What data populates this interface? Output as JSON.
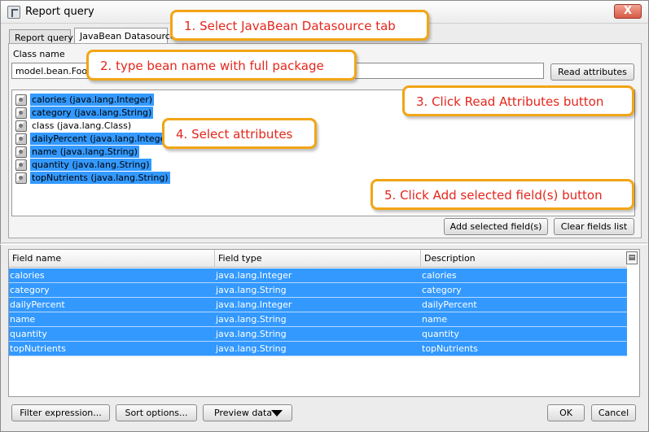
{
  "window": {
    "title": "Report query",
    "close_label": "X"
  },
  "tabs": [
    {
      "label": "Report query"
    },
    {
      "label": "JavaBean Datasource"
    }
  ],
  "class_name": {
    "label": "Class name",
    "value": "model.bean.Food"
  },
  "buttons": {
    "read_attributes": "Read attributes",
    "add_selected": "Add selected field(s)",
    "clear_fields": "Clear fields list",
    "filter_expression": "Filter expression...",
    "sort_options": "Sort options...",
    "preview_data": "Preview data",
    "ok": "OK",
    "cancel": "Cancel"
  },
  "attributes": [
    {
      "text": "calories (java.lang.Integer)",
      "selected": true
    },
    {
      "text": "category (java.lang.String)",
      "selected": true
    },
    {
      "text": "class (java.lang.Class)",
      "selected": false
    },
    {
      "text": "dailyPercent (java.lang.Integer)",
      "selected": true
    },
    {
      "text": "name (java.lang.String)",
      "selected": true
    },
    {
      "text": "quantity (java.lang.String)",
      "selected": true
    },
    {
      "text": "topNutrients (java.lang.String)",
      "selected": true
    }
  ],
  "table": {
    "columns": [
      "Field name",
      "Field type",
      "Description"
    ],
    "rows": [
      [
        "calories",
        "java.lang.Integer",
        "calories"
      ],
      [
        "category",
        "java.lang.String",
        "category"
      ],
      [
        "dailyPercent",
        "java.lang.Integer",
        "dailyPercent"
      ],
      [
        "name",
        "java.lang.String",
        "name"
      ],
      [
        "quantity",
        "java.lang.String",
        "quantity"
      ],
      [
        "topNutrients",
        "java.lang.String",
        "topNutrients"
      ]
    ]
  },
  "callouts": [
    "1. Select JavaBean Datasource tab",
    "2. type bean name with full package",
    "3. Click Read Attributes button",
    "4. Select attributes",
    "5. Click Add selected field(s) button"
  ],
  "colors": {
    "selection": "#3399ff",
    "callout_border": "#f2a516",
    "callout_text": "#e3261c"
  }
}
